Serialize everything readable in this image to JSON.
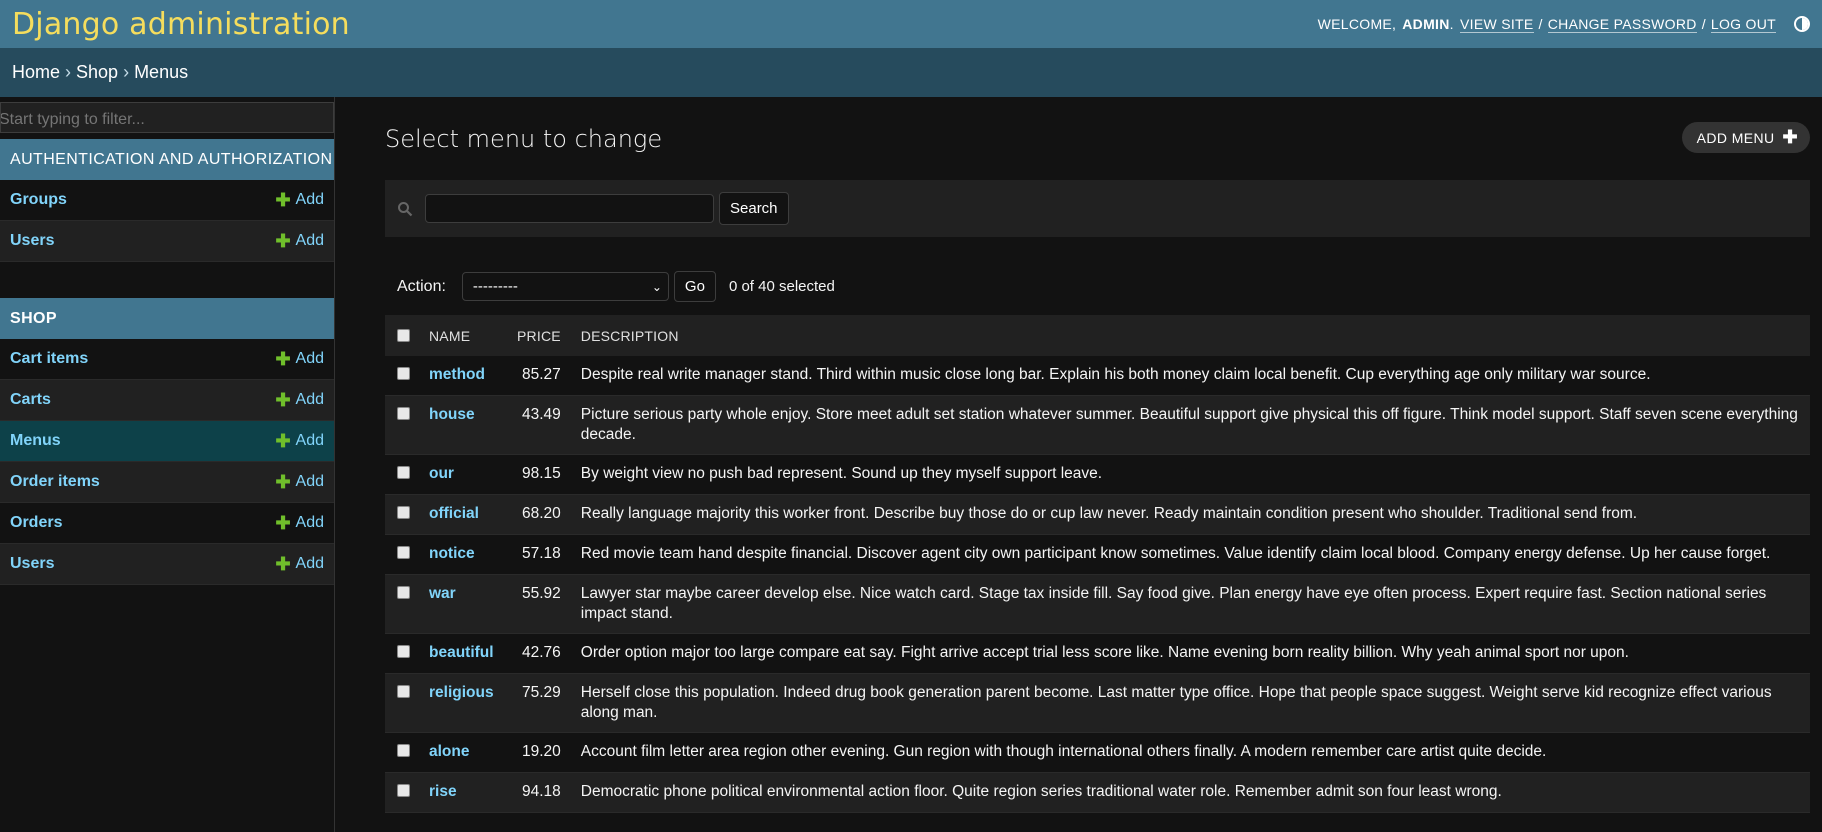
{
  "header": {
    "branding": "Django administration",
    "welcome": "WELCOME,",
    "username": "ADMIN",
    "view_site": "VIEW SITE",
    "change_password": "CHANGE PASSWORD",
    "log_out": "LOG OUT",
    "separator": "/"
  },
  "breadcrumbs": [
    "Home",
    "Shop",
    "Menus"
  ],
  "breadcrumb_sep": "›",
  "sidebar": {
    "filter_placeholder": "Start typing to filter...",
    "add_label": "Add",
    "apps": [
      {
        "caption": "AUTHENTICATION AND AUTHORIZATION",
        "models": [
          "Groups",
          "Users"
        ]
      },
      {
        "caption": "SHOP",
        "models": [
          "Cart items",
          "Carts",
          "Menus",
          "Order items",
          "Orders",
          "Users"
        ]
      }
    ],
    "current_model": "Menus"
  },
  "content": {
    "title": "Select menu to change",
    "add_button": "ADD MENU",
    "search_button": "Search",
    "search_value": "",
    "action_label": "Action:",
    "action_selected": "---------",
    "go_button": "Go",
    "selected_count": "0 of 40 selected",
    "columns": [
      "NAME",
      "PRICE",
      "DESCRIPTION"
    ],
    "rows": [
      {
        "name": "method",
        "price": "85.27",
        "description": "Despite real write manager stand. Third within music close long bar. Explain his both money claim local benefit. Cup everything age only military war source."
      },
      {
        "name": "house",
        "price": "43.49",
        "description": "Picture serious party whole enjoy. Store meet adult set station whatever summer. Beautiful support give physical this off figure. Think model support. Staff seven scene everything decade."
      },
      {
        "name": "our",
        "price": "98.15",
        "description": "By weight view no push bad represent. Sound up they myself support leave."
      },
      {
        "name": "official",
        "price": "68.20",
        "description": "Really language majority this worker front. Describe buy those do or cup law never. Ready maintain condition present who shoulder. Traditional send from."
      },
      {
        "name": "notice",
        "price": "57.18",
        "description": "Red movie team hand despite financial. Discover agent city own participant know sometimes. Value identify claim local blood. Company energy defense. Up her cause forget."
      },
      {
        "name": "war",
        "price": "55.92",
        "description": "Lawyer star maybe career develop else. Nice watch card. Stage tax inside fill. Say food give. Plan energy have eye often process. Expert require fast. Section national series impact stand."
      },
      {
        "name": "beautiful",
        "price": "42.76",
        "description": "Order option major too large compare eat say. Fight arrive accept trial less score like. Name evening born reality billion. Why yeah animal sport nor upon."
      },
      {
        "name": "religious",
        "price": "75.29",
        "description": "Herself close this population. Indeed drug book generation parent become. Last matter type office. Hope that people space suggest. Weight serve kid recognize effect various along man."
      },
      {
        "name": "alone",
        "price": "19.20",
        "description": "Account film letter area region other evening. Gun region with though international others finally. A modern remember care artist quite decide."
      },
      {
        "name": "rise",
        "price": "94.18",
        "description": "Democratic phone political environmental action floor. Quite region series traditional water role. Remember admit son four least wrong."
      }
    ]
  },
  "colors": {
    "header_bg": "#417690",
    "breadcrumbs_bg": "#264b5d",
    "branding": "#f5dd5d",
    "link": "#81d4fa",
    "add_plus": "#70bf2b",
    "current_row": "#0d4149"
  }
}
